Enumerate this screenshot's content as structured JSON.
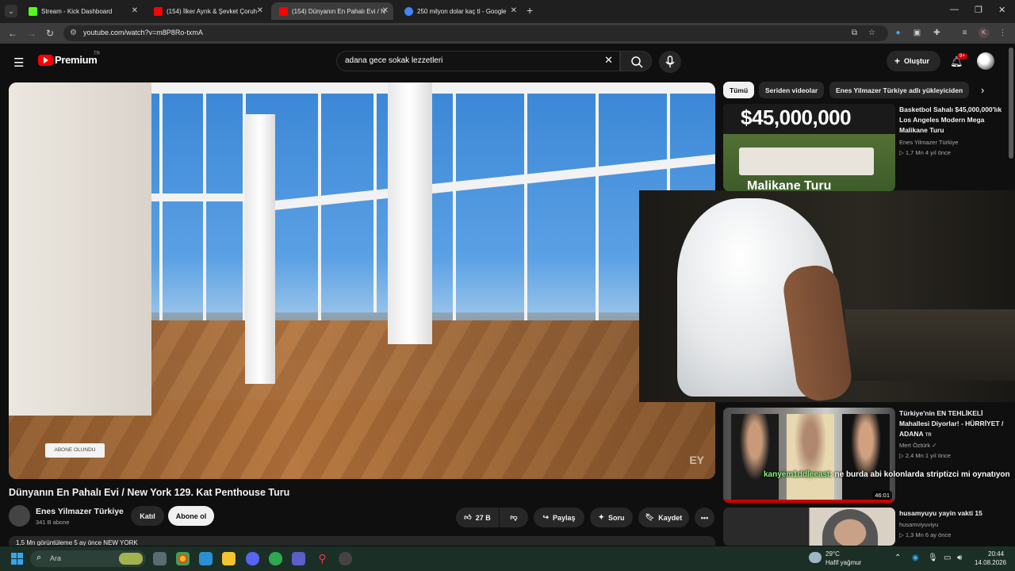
{
  "browser": {
    "tabs": [
      {
        "title": "Stream - Kick Dashboard",
        "favicon_color": "#53fc18",
        "active": false
      },
      {
        "title": "(154) İlker Ayrık & Şevket Çoruh",
        "favicon_color": "#ff0000",
        "active": false
      },
      {
        "title": "(154) Dünyanın En Pahalı Evi / N",
        "favicon_color": "#ff0000",
        "active": true
      },
      {
        "title": "250 milyon dolar kaç tl - Google",
        "favicon_color": "#4285f4",
        "active": false
      }
    ],
    "url": "youtube.com/watch?v=m8P8Ro-txmA"
  },
  "youtube": {
    "brand": "Premium",
    "country_code": "TR",
    "search_query": "adana gece sokak lezzetleri",
    "create_label": "Oluştur",
    "notification_badge": "9+"
  },
  "player": {
    "subscribe_overlay": "ABONE OLUNDU",
    "watermark": "EY"
  },
  "video": {
    "title": "Dünyanın En Pahalı Evi / New York 129. Kat Penthouse Turu",
    "channel": "Enes Yilmazer Türkiye",
    "subscribers": "341 B abone",
    "join_label": "Katıl",
    "subscribe_label": "Abone ol",
    "likes": "27 B",
    "share_label": "Paylaş",
    "ask_label": "Soru",
    "save_label": "Kaydet",
    "description_line": "1,5 Mn görüntüleme  5 ay önce  NEW YORK"
  },
  "sidebar": {
    "chips": [
      "Tümü",
      "Seriden videolar",
      "Enes Yilmazer Türkiye adlı yükleyiciden"
    ],
    "thumb_banner": "$45,000,000",
    "thumb_caption": "Malikane Turu",
    "items": [
      {
        "title": "Basketbol Sahalı $45,000,000'lık Los Angeles Modern Mega Malikane Turu",
        "channel": "Enes Yilmazer Türkiye",
        "meta": "▷ 1,7 Mn   4 yıl önce"
      },
      {
        "title": "Türkiye'nin EN TEHLİKELİ Mahallesi Diyorlar! - HÜRRİYET / ADANA",
        "channel": "Mert Öztürk",
        "meta": "▷ 2,4 Mn   1 yıl önce",
        "duration": "46:01",
        "country": "TR"
      },
      {
        "title": "husamyuyu yayin vakti 15",
        "channel": "husamviyuviyu",
        "meta": "▷ 1,3 Mn   6 ay önce"
      }
    ]
  },
  "chat_overlay": {
    "username": "kanyem1ddleeast",
    "message": ": ne burda abi kolonlarda striptizci mi oynatıyon"
  },
  "taskbar": {
    "search_placeholder": "Ara",
    "temperature": "29°C",
    "weather": "Hafif yağmur",
    "time": "20:44",
    "date": "14.08.2026"
  }
}
